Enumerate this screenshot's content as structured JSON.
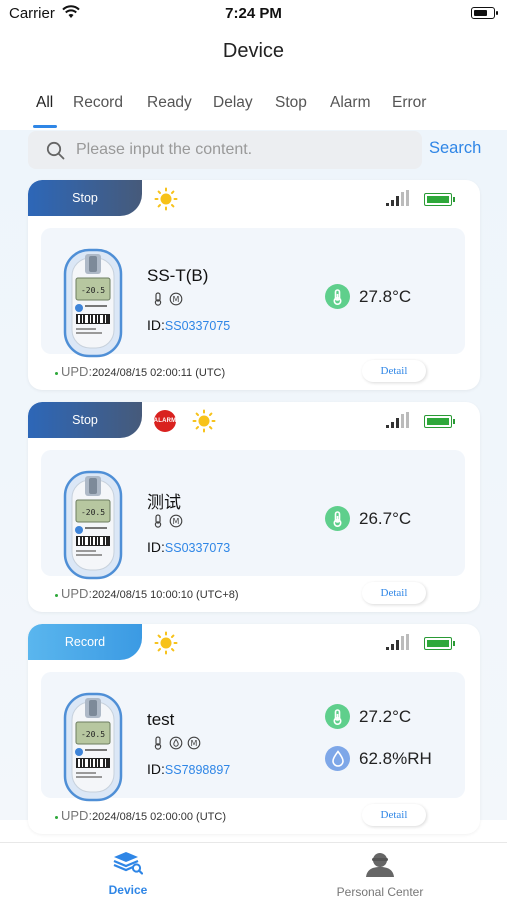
{
  "status_bar": {
    "carrier": "Carrier",
    "time": "7:24 PM"
  },
  "header": {
    "title": "Device"
  },
  "tabs": [
    {
      "label": "All",
      "active": true
    },
    {
      "label": "Record",
      "active": false
    },
    {
      "label": "Ready",
      "active": false
    },
    {
      "label": "Delay",
      "active": false
    },
    {
      "label": "Stop",
      "active": false
    },
    {
      "label": "Alarm",
      "active": false
    },
    {
      "label": "Error",
      "active": false
    }
  ],
  "search": {
    "placeholder": "Please input the content.",
    "value": "",
    "button_label": "Search"
  },
  "devices": [
    {
      "status": "Stop",
      "alarm": false,
      "name": "SS-T(B)",
      "id_label": "ID:",
      "id": "SS0337075",
      "temperature": "27.8°C",
      "humidity": null,
      "upd_label": "UPD:",
      "upd": "2024/08/15 02:00:11 (UTC)",
      "detail_label": "Detail"
    },
    {
      "status": "Stop",
      "alarm": true,
      "alarm_label": "ALARM",
      "name": "测试",
      "id_label": "ID:",
      "id": "SS0337073",
      "temperature": "26.7°C",
      "humidity": null,
      "upd_label": "UPD:",
      "upd": "2024/08/15 10:00:10 (UTC+8)",
      "detail_label": "Detail"
    },
    {
      "status": "Record",
      "alarm": false,
      "name": "test",
      "id_label": "ID:",
      "id": "SS7898897",
      "temperature": "27.2°C",
      "humidity": "62.8%RH",
      "upd_label": "UPD:",
      "upd": "2024/08/15 02:00:00 (UTC)",
      "detail_label": "Detail"
    }
  ],
  "bottom_nav": [
    {
      "label": "Device",
      "icon": "device-nav-icon",
      "active": true
    },
    {
      "label": "Personal Center",
      "icon": "person-icon",
      "active": false
    }
  ],
  "colors": {
    "accent": "#2f86e6",
    "status_stop": "#2d67b8",
    "status_record": "#3b9ae3",
    "temperature_badge": "#5fcf8c",
    "humidity_badge": "#7ea7e8",
    "battery": "#2ea83a",
    "alarm": "#d9211f"
  }
}
